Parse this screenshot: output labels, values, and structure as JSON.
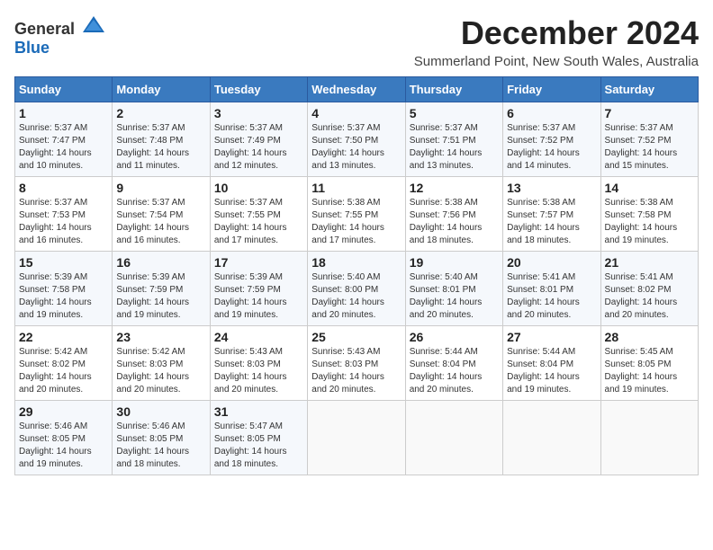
{
  "logo": {
    "general": "General",
    "blue": "Blue"
  },
  "title": "December 2024",
  "subtitle": "Summerland Point, New South Wales, Australia",
  "weekdays": [
    "Sunday",
    "Monday",
    "Tuesday",
    "Wednesday",
    "Thursday",
    "Friday",
    "Saturday"
  ],
  "weeks": [
    [
      {
        "day": "1",
        "sunrise": "5:37 AM",
        "sunset": "7:47 PM",
        "daylight": "14 hours and 10 minutes."
      },
      {
        "day": "2",
        "sunrise": "5:37 AM",
        "sunset": "7:48 PM",
        "daylight": "14 hours and 11 minutes."
      },
      {
        "day": "3",
        "sunrise": "5:37 AM",
        "sunset": "7:49 PM",
        "daylight": "14 hours and 12 minutes."
      },
      {
        "day": "4",
        "sunrise": "5:37 AM",
        "sunset": "7:50 PM",
        "daylight": "14 hours and 13 minutes."
      },
      {
        "day": "5",
        "sunrise": "5:37 AM",
        "sunset": "7:51 PM",
        "daylight": "14 hours and 13 minutes."
      },
      {
        "day": "6",
        "sunrise": "5:37 AM",
        "sunset": "7:52 PM",
        "daylight": "14 hours and 14 minutes."
      },
      {
        "day": "7",
        "sunrise": "5:37 AM",
        "sunset": "7:52 PM",
        "daylight": "14 hours and 15 minutes."
      }
    ],
    [
      {
        "day": "8",
        "sunrise": "5:37 AM",
        "sunset": "7:53 PM",
        "daylight": "14 hours and 16 minutes."
      },
      {
        "day": "9",
        "sunrise": "5:37 AM",
        "sunset": "7:54 PM",
        "daylight": "14 hours and 16 minutes."
      },
      {
        "day": "10",
        "sunrise": "5:37 AM",
        "sunset": "7:55 PM",
        "daylight": "14 hours and 17 minutes."
      },
      {
        "day": "11",
        "sunrise": "5:38 AM",
        "sunset": "7:55 PM",
        "daylight": "14 hours and 17 minutes."
      },
      {
        "day": "12",
        "sunrise": "5:38 AM",
        "sunset": "7:56 PM",
        "daylight": "14 hours and 18 minutes."
      },
      {
        "day": "13",
        "sunrise": "5:38 AM",
        "sunset": "7:57 PM",
        "daylight": "14 hours and 18 minutes."
      },
      {
        "day": "14",
        "sunrise": "5:38 AM",
        "sunset": "7:58 PM",
        "daylight": "14 hours and 19 minutes."
      }
    ],
    [
      {
        "day": "15",
        "sunrise": "5:39 AM",
        "sunset": "7:58 PM",
        "daylight": "14 hours and 19 minutes."
      },
      {
        "day": "16",
        "sunrise": "5:39 AM",
        "sunset": "7:59 PM",
        "daylight": "14 hours and 19 minutes."
      },
      {
        "day": "17",
        "sunrise": "5:39 AM",
        "sunset": "7:59 PM",
        "daylight": "14 hours and 19 minutes."
      },
      {
        "day": "18",
        "sunrise": "5:40 AM",
        "sunset": "8:00 PM",
        "daylight": "14 hours and 20 minutes."
      },
      {
        "day": "19",
        "sunrise": "5:40 AM",
        "sunset": "8:01 PM",
        "daylight": "14 hours and 20 minutes."
      },
      {
        "day": "20",
        "sunrise": "5:41 AM",
        "sunset": "8:01 PM",
        "daylight": "14 hours and 20 minutes."
      },
      {
        "day": "21",
        "sunrise": "5:41 AM",
        "sunset": "8:02 PM",
        "daylight": "14 hours and 20 minutes."
      }
    ],
    [
      {
        "day": "22",
        "sunrise": "5:42 AM",
        "sunset": "8:02 PM",
        "daylight": "14 hours and 20 minutes."
      },
      {
        "day": "23",
        "sunrise": "5:42 AM",
        "sunset": "8:03 PM",
        "daylight": "14 hours and 20 minutes."
      },
      {
        "day": "24",
        "sunrise": "5:43 AM",
        "sunset": "8:03 PM",
        "daylight": "14 hours and 20 minutes."
      },
      {
        "day": "25",
        "sunrise": "5:43 AM",
        "sunset": "8:03 PM",
        "daylight": "14 hours and 20 minutes."
      },
      {
        "day": "26",
        "sunrise": "5:44 AM",
        "sunset": "8:04 PM",
        "daylight": "14 hours and 20 minutes."
      },
      {
        "day": "27",
        "sunrise": "5:44 AM",
        "sunset": "8:04 PM",
        "daylight": "14 hours and 19 minutes."
      },
      {
        "day": "28",
        "sunrise": "5:45 AM",
        "sunset": "8:05 PM",
        "daylight": "14 hours and 19 minutes."
      }
    ],
    [
      {
        "day": "29",
        "sunrise": "5:46 AM",
        "sunset": "8:05 PM",
        "daylight": "14 hours and 19 minutes."
      },
      {
        "day": "30",
        "sunrise": "5:46 AM",
        "sunset": "8:05 PM",
        "daylight": "14 hours and 18 minutes."
      },
      {
        "day": "31",
        "sunrise": "5:47 AM",
        "sunset": "8:05 PM",
        "daylight": "14 hours and 18 minutes."
      },
      null,
      null,
      null,
      null
    ]
  ]
}
